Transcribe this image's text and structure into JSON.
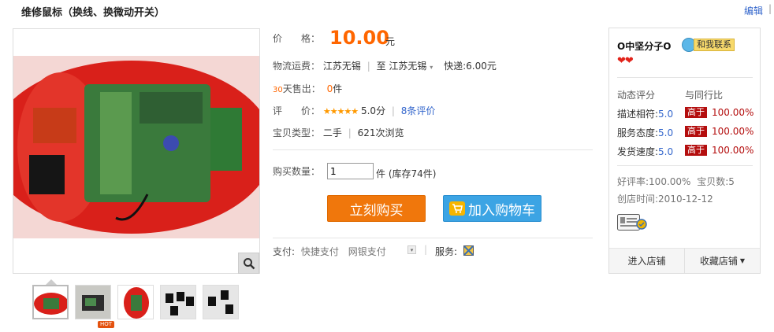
{
  "title": "维修鼠标（换线、换微动开关）",
  "header": {
    "edit_label": "编辑",
    "edit_sep": "|"
  },
  "price": {
    "label": "价　　格：",
    "value": "10.00",
    "currency": "元"
  },
  "shipping": {
    "label": "物流运费：",
    "from": "江苏无锡",
    "to_prefix": "至",
    "to": "江苏无锡",
    "express": "快递:6.00元"
  },
  "sales": {
    "days": "30",
    "label": "天售出：",
    "count": "0",
    "unit": "件"
  },
  "rating": {
    "label": "评　　价：",
    "stars": "★★★★★",
    "score": "5.0分",
    "reviews": "8条评价"
  },
  "item_type": {
    "label": "宝贝类型：",
    "type": "二手",
    "views": "621次浏览"
  },
  "quantity": {
    "label": "购买数量：",
    "value": "1",
    "stock": "件 (库存74件)"
  },
  "buttons": {
    "buy_now": "立刻购买",
    "add_cart": "加入购物车"
  },
  "payment": {
    "label": "支付:",
    "method1": "快捷支付",
    "method2": "网银支付",
    "service_label": "服务:"
  },
  "thumbs": {
    "hot_badge": "HOT"
  },
  "shop": {
    "name": "O中坚分子O",
    "contact_label": "和我联系",
    "hearts": "❤❤",
    "score_header": "动态评分",
    "compare_header": "与同行比",
    "ratings": [
      {
        "label": "描述相符:",
        "value": "5.0",
        "tag": "高于",
        "pct": "100.00%"
      },
      {
        "label": "服务态度:",
        "value": "5.0",
        "tag": "高于",
        "pct": "100.00%"
      },
      {
        "label": "发货速度:",
        "value": "5.0",
        "tag": "高于",
        "pct": "100.00%"
      }
    ],
    "good_rate": "好评率:100.00%",
    "item_count": "宝贝数:5",
    "created": "创店时间:2010-12-12",
    "enter_shop": "进入店铺",
    "favorite_shop": "收藏店铺"
  },
  "colors": {
    "price": "#ff6600",
    "link": "#3366cc",
    "buy": "#f0770c",
    "cart": "#3ca4e4",
    "tag": "#b40e0e"
  }
}
